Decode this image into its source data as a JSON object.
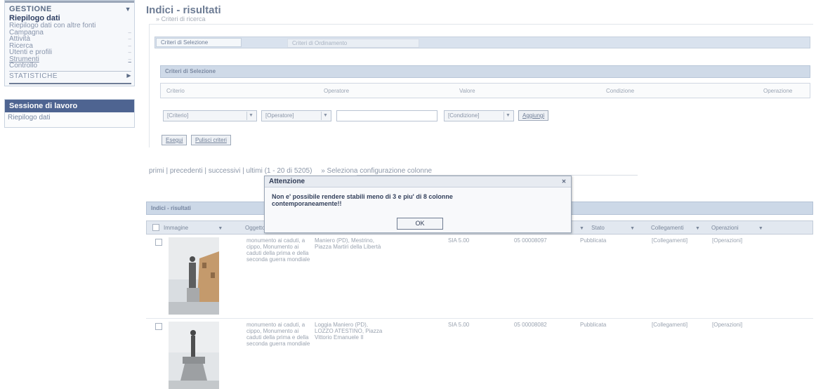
{
  "sidebar": {
    "menu_header": "GESTIONE",
    "current_item": "Riepilogo dati",
    "items": [
      {
        "label": "Riepilogo dati con altre fonti",
        "marker": ""
      },
      {
        "label": "Campagna",
        "marker": "–"
      },
      {
        "label": "Attività",
        "marker": "–"
      },
      {
        "label": "Ricerca",
        "marker": "–"
      },
      {
        "label": "Utenti e profili",
        "marker": "–"
      },
      {
        "label": "Strumenti",
        "marker": "–"
      },
      {
        "label": "Controllo",
        "marker": ""
      }
    ],
    "statistiche": "STATISTICHE",
    "session_title": "Sessione di lavoro",
    "session_item": "Riepilogo dati"
  },
  "main": {
    "title": "Indici - risultati",
    "criteria_toggle": "» Criteri di ricerca",
    "tab_active": "Criteri di Selezione",
    "tab_inactive": "Criteri di Ordinamento",
    "selection_header": "Criteri di Selezione",
    "columns": {
      "criterio": "Criterio",
      "operatore": "Operatore",
      "valore": "Valore",
      "condizione": "Condizione",
      "operazione": "Operazione"
    },
    "criterio_select": "[Criterio]",
    "operatore_select": "[Operatore]",
    "condizione_select": "[Condizione]",
    "aggiungi_button": "Aggiungi",
    "esegui_button": "Esegui",
    "pulisci_button": "Pulisci criteri",
    "pagination": {
      "primi": "primi",
      "precedenti": "precedenti",
      "successivi": "successivi",
      "ultimi": "ultimi (1 - 20 di 5205)",
      "sep": "|",
      "columns_link": "» Seleziona configurazione colonne"
    },
    "results_header": "Indici - risultati",
    "table_headers": {
      "immagine": "Immagine",
      "oggetto": "Oggetto",
      "stato": "Stato",
      "collegamenti": "Collegamenti",
      "operazioni": "Operazioni"
    },
    "rows": [
      {
        "oggetto": "monumento ai caduti, a cippo, Monumento ai caduti della prima e della seconda guerra mondiale",
        "luogo": "Maniero (PD), Mestrino, Piazza Martiri della Libertà",
        "cod": "SIA 5.00",
        "id": "05 00008097",
        "stato": "Pubblicata",
        "collegamenti": "[Collegamenti]",
        "operazioni": "[Operazioni]"
      },
      {
        "oggetto": "monumento ai caduti, a cippo, Monumento ai caduti della prima e della seconda guerra mondiale",
        "luogo": "Loggia Maniero (PD), LOZZO ATESTINO, Piazza Vittorio Emanuele II",
        "cod": "SIA 5.00",
        "id": "05 00008082",
        "stato": "Pubblicata",
        "collegamenti": "[Collegamenti]",
        "operazioni": "[Operazioni]"
      }
    ]
  },
  "dialog": {
    "title": "Attenzione",
    "message_line1": "Non e' possibile rendere stabili meno di 3 e piu' di 8 colonne",
    "message_line2": "contemporaneamente!!",
    "ok_label": "OK",
    "close_glyph": "✕"
  }
}
